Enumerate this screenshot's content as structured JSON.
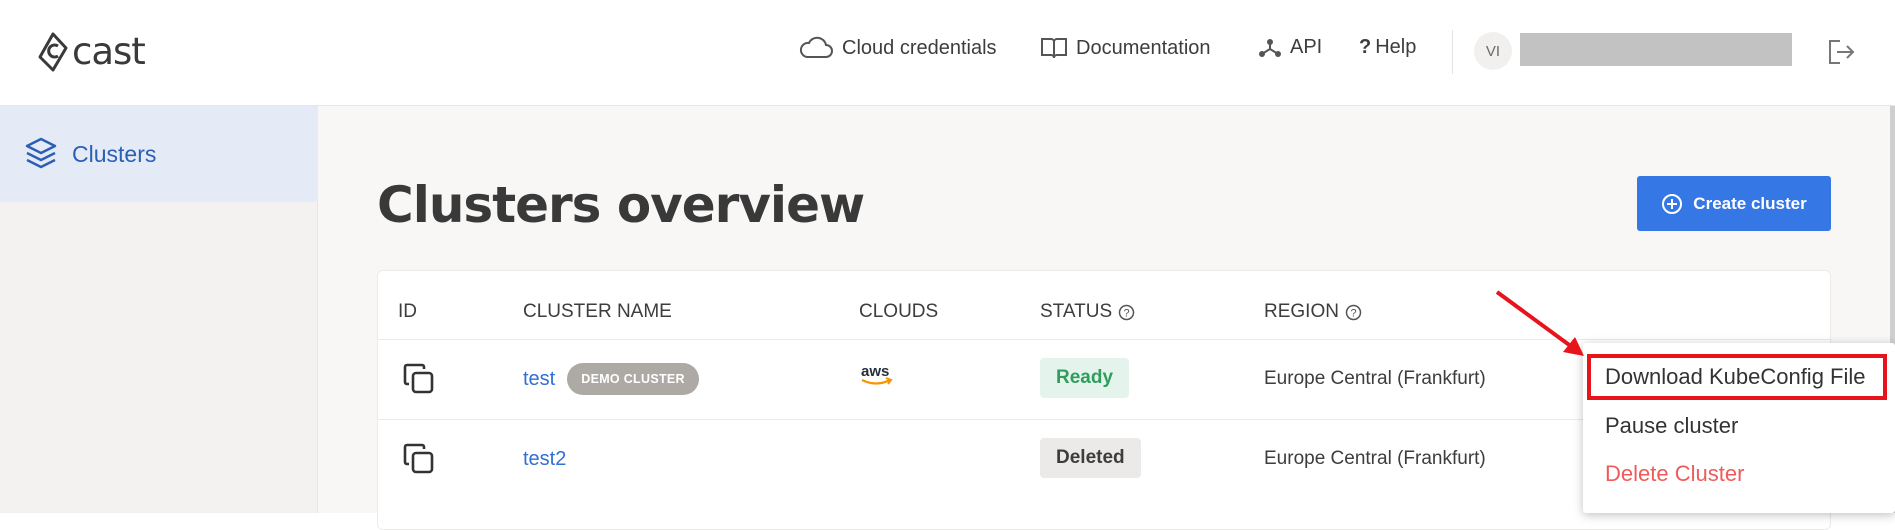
{
  "brand": {
    "logo_text": "cast"
  },
  "header": {
    "nav": [
      {
        "label": "Cloud credentials",
        "icon": "cloud-icon"
      },
      {
        "label": "Documentation",
        "icon": "book-icon"
      },
      {
        "label": "API",
        "icon": "api-nodes-icon"
      },
      {
        "label": "Help",
        "icon": "question-mark-icon"
      }
    ],
    "user_initials": "VI",
    "logout_icon": "logout-icon"
  },
  "sidebar": {
    "items": [
      {
        "label": "Clusters",
        "icon": "layers-icon",
        "active": true
      }
    ]
  },
  "main": {
    "title": "Clusters overview",
    "create_button_label": "Create cluster"
  },
  "table": {
    "columns": [
      "ID",
      "CLUSTER NAME",
      "CLOUDS",
      "STATUS",
      "REGION"
    ],
    "rows": [
      {
        "name": "test",
        "badge": "DEMO CLUSTER",
        "cloud": "aws",
        "status": "Ready",
        "region": "Europe Central (Frankfurt)"
      },
      {
        "name": "test2",
        "badge": "",
        "cloud": "",
        "status": "Deleted",
        "region": "Europe Central (Frankfurt)"
      }
    ]
  },
  "context_menu": {
    "items": [
      {
        "label": "Download KubeConfig File",
        "color": "#333333",
        "highlighted": true
      },
      {
        "label": "Pause cluster",
        "color": "#333333"
      },
      {
        "label": "Delete Cluster",
        "color": "#f05a5a"
      }
    ]
  },
  "colors": {
    "accent": "#3577e4",
    "link": "#2f6fd6",
    "ready": "#2f9e5c",
    "danger": "#f05a5a",
    "annotation": "#e8141c"
  }
}
